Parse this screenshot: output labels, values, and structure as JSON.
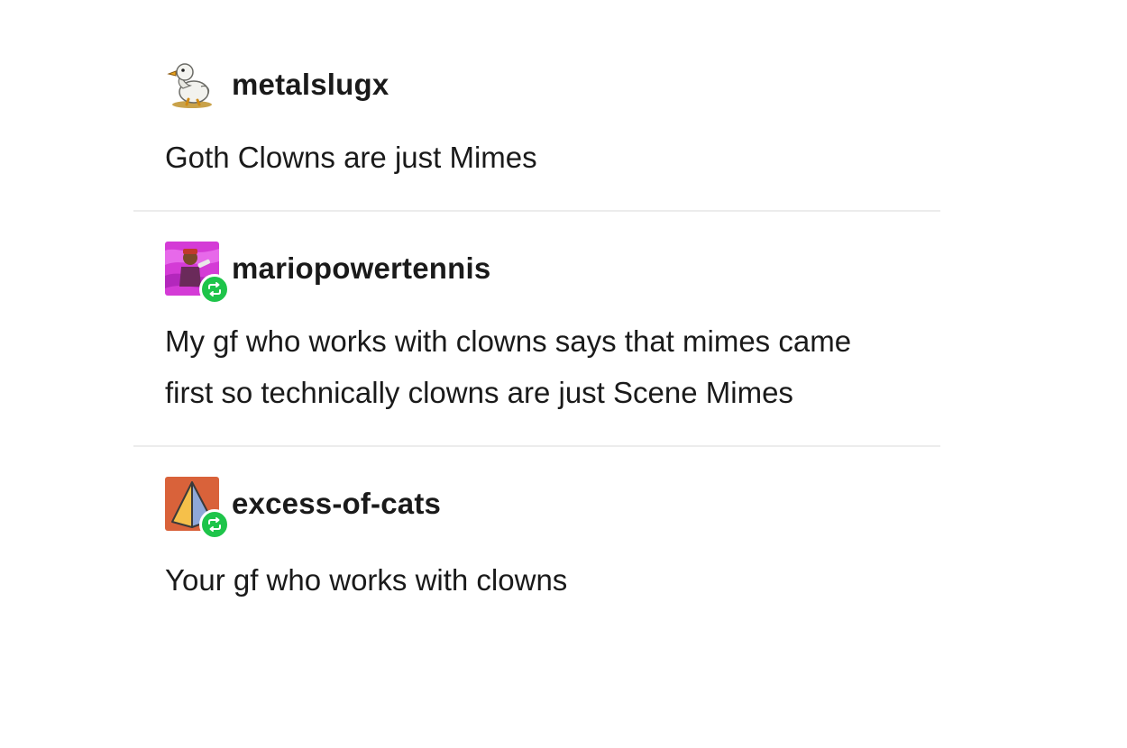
{
  "thread": {
    "posts": [
      {
        "username": "metalslugx",
        "avatar_icon": "duck-avatar-icon",
        "reblog": false,
        "body": "Goth Clowns are just Mimes"
      },
      {
        "username": "mariopowertennis",
        "avatar_icon": "character-avatar-icon",
        "reblog": true,
        "body": "My gf who works with clowns says that mimes came first so technically clowns are just Scene Mimes"
      },
      {
        "username": "excess-of-cats",
        "avatar_icon": "pyramid-avatar-icon",
        "reblog": true,
        "body": "Your gf who works with clowns"
      }
    ]
  },
  "colors": {
    "text": "#1a1a1a",
    "divider": "#ececec",
    "reblog_badge": "#1ec44a"
  }
}
